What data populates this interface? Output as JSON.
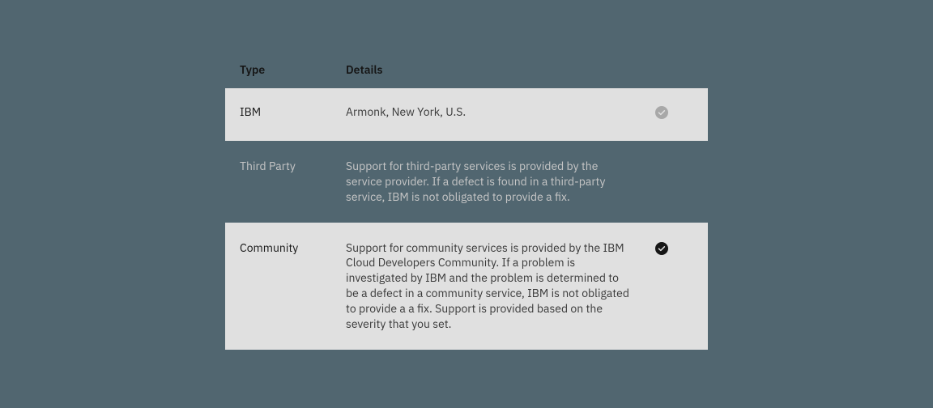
{
  "table": {
    "headers": {
      "type": "Type",
      "details": "Details"
    },
    "rows": [
      {
        "type": "IBM",
        "details": "Armonk, New York, U.S.",
        "shaded": true,
        "checked": true,
        "check_fill": "#a8a8a8",
        "check_tick": "#e0e0e0"
      },
      {
        "type": "Third Party",
        "details": "Support for third-party services is provided by the service provider. If a defect is found in a third-party service, IBM is not obligated to provide a fix.",
        "shaded": false,
        "checked": false
      },
      {
        "type": "Community",
        "details": "Support for community services is provided by the IBM Cloud Developers Community. If a problem is investigated by IBM and the problem is determined to be a defect in a community service, IBM is not obligated to provide a a fix. Support is provided based on the severity that you set.",
        "shaded": true,
        "checked": true,
        "check_fill": "#161616",
        "check_tick": "#e0e0e0"
      }
    ]
  }
}
